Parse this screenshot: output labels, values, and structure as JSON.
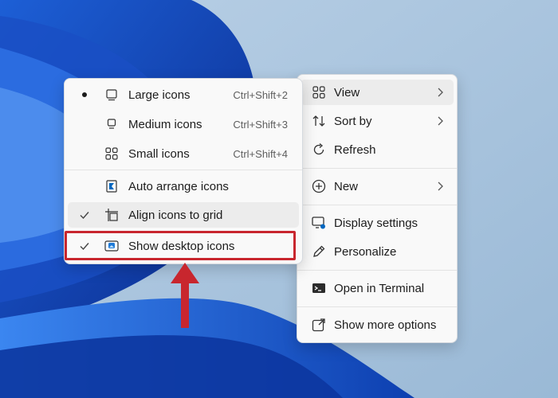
{
  "colors": {
    "highlight": "#c8262e",
    "accent": "#0067c0",
    "menu_bg": "#f9f9f9"
  },
  "main_menu": {
    "items": [
      {
        "icon": "grid-four-icon",
        "label": "View",
        "submenu": true
      },
      {
        "icon": "sort-arrows-icon",
        "label": "Sort by",
        "submenu": true
      },
      {
        "icon": "refresh-icon",
        "label": "Refresh"
      },
      {
        "icon": "plus-circle-icon",
        "label": "New",
        "submenu": true
      },
      {
        "icon": "display-settings-icon",
        "label": "Display settings"
      },
      {
        "icon": "pen-icon",
        "label": "Personalize"
      },
      {
        "icon": "terminal-icon",
        "label": "Open in Terminal"
      },
      {
        "icon": "external-link-icon",
        "label": "Show more options"
      }
    ]
  },
  "view_submenu": {
    "items": [
      {
        "icon": "monitor-icon",
        "label": "Large icons",
        "shortcut": "Ctrl+Shift+2",
        "selected": true
      },
      {
        "icon": "monitor-small-icon",
        "label": "Medium icons",
        "shortcut": "Ctrl+Shift+3"
      },
      {
        "icon": "grid-four-icon",
        "label": "Small icons",
        "shortcut": "Ctrl+Shift+4"
      },
      {
        "icon": "auto-arrange-icon",
        "label": "Auto arrange icons"
      },
      {
        "icon": "grid-align-icon",
        "label": "Align icons to grid",
        "checked": true
      },
      {
        "icon": "desktop-icons-icon",
        "label": "Show desktop icons",
        "checked": true
      }
    ]
  }
}
